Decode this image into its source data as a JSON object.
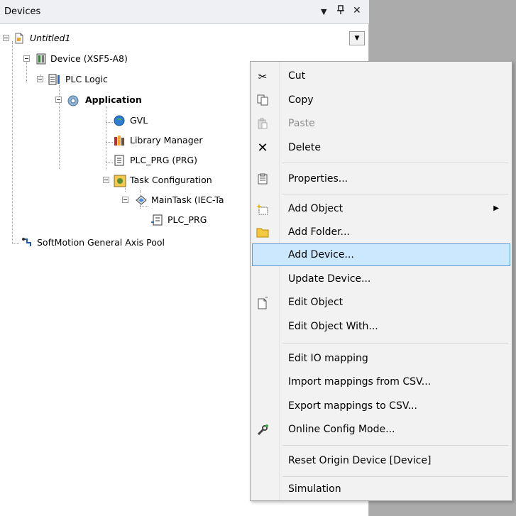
{
  "panel": {
    "title": "Devices"
  },
  "titlebar": {
    "dropdown_icon": "▾",
    "pin_icon": "⊣",
    "close_icon": "✕"
  },
  "tree": {
    "nodes": [
      {
        "label": "Untitled1"
      },
      {
        "label": "Device (XSF5-A8)"
      },
      {
        "label": "PLC Logic"
      },
      {
        "label": "Application"
      },
      {
        "label": "GVL"
      },
      {
        "label": "Library Manager"
      },
      {
        "label": "PLC_PRG (PRG)"
      },
      {
        "label": "Task Configuration"
      },
      {
        "label": "MainTask (IEC-Ta"
      },
      {
        "label": "PLC_PRG"
      },
      {
        "label": "SoftMotion General Axis Pool"
      }
    ]
  },
  "menu": {
    "items": [
      {
        "label": "Cut",
        "icon": "scissors-icon"
      },
      {
        "label": "Copy",
        "icon": "copy-icon"
      },
      {
        "label": "Paste",
        "icon": "paste-icon"
      },
      {
        "label": "Delete",
        "icon": "delete-icon"
      },
      {
        "label": "Properties...",
        "icon": "properties-icon"
      },
      {
        "label": "Add Object",
        "icon": "add-object-icon"
      },
      {
        "label": "Add Folder...",
        "icon": "folder-icon"
      },
      {
        "label": "Add Device..."
      },
      {
        "label": "Update Device..."
      },
      {
        "label": "Edit Object",
        "icon": "edit-object-icon"
      },
      {
        "label": "Edit Object With..."
      },
      {
        "label": "Edit IO mapping"
      },
      {
        "label": "Import mappings from CSV..."
      },
      {
        "label": "Export mappings to CSV..."
      },
      {
        "label": "Online Config Mode...",
        "icon": "wrench-icon"
      },
      {
        "label": "Reset Origin Device [Device]"
      },
      {
        "label": "Simulation"
      }
    ]
  },
  "colors": {
    "selection_bg": "#cce8ff",
    "selection_border": "#5b9bd5",
    "menu_bg": "#f2f2f2",
    "right_area": "#ababab"
  }
}
